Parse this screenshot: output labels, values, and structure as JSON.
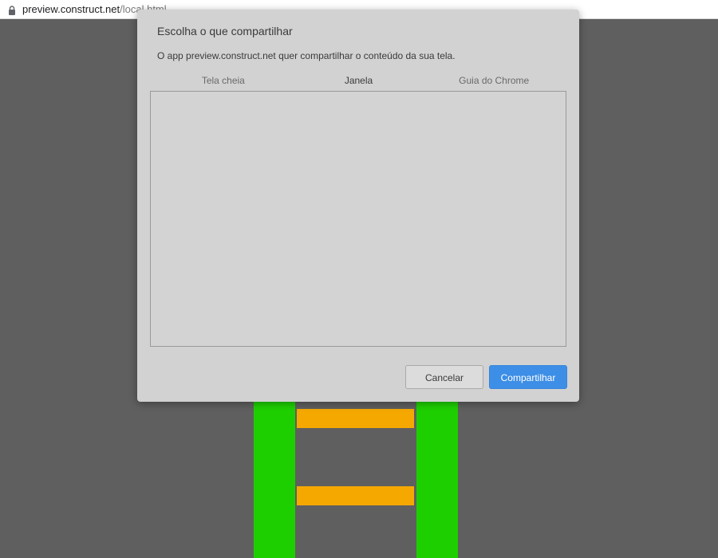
{
  "browser": {
    "url_domain": "preview.construct.net",
    "url_path": "/local.html"
  },
  "dialog": {
    "title": "Escolha o que compartilhar",
    "subtitle": "O app preview.construct.net quer compartilhar o conteúdo da sua tela.",
    "tabs": [
      {
        "label": "Tela cheia",
        "active": false
      },
      {
        "label": "Janela",
        "active": true
      },
      {
        "label": "Guia do Chrome",
        "active": false
      }
    ],
    "cancel_label": "Cancelar",
    "share_label": "Compartilhar"
  },
  "colors": {
    "background": "#5f5f5f",
    "ladder_rail": "#1ecf00",
    "ladder_rung": "#f5a800",
    "accent": "#3d8ee6"
  }
}
